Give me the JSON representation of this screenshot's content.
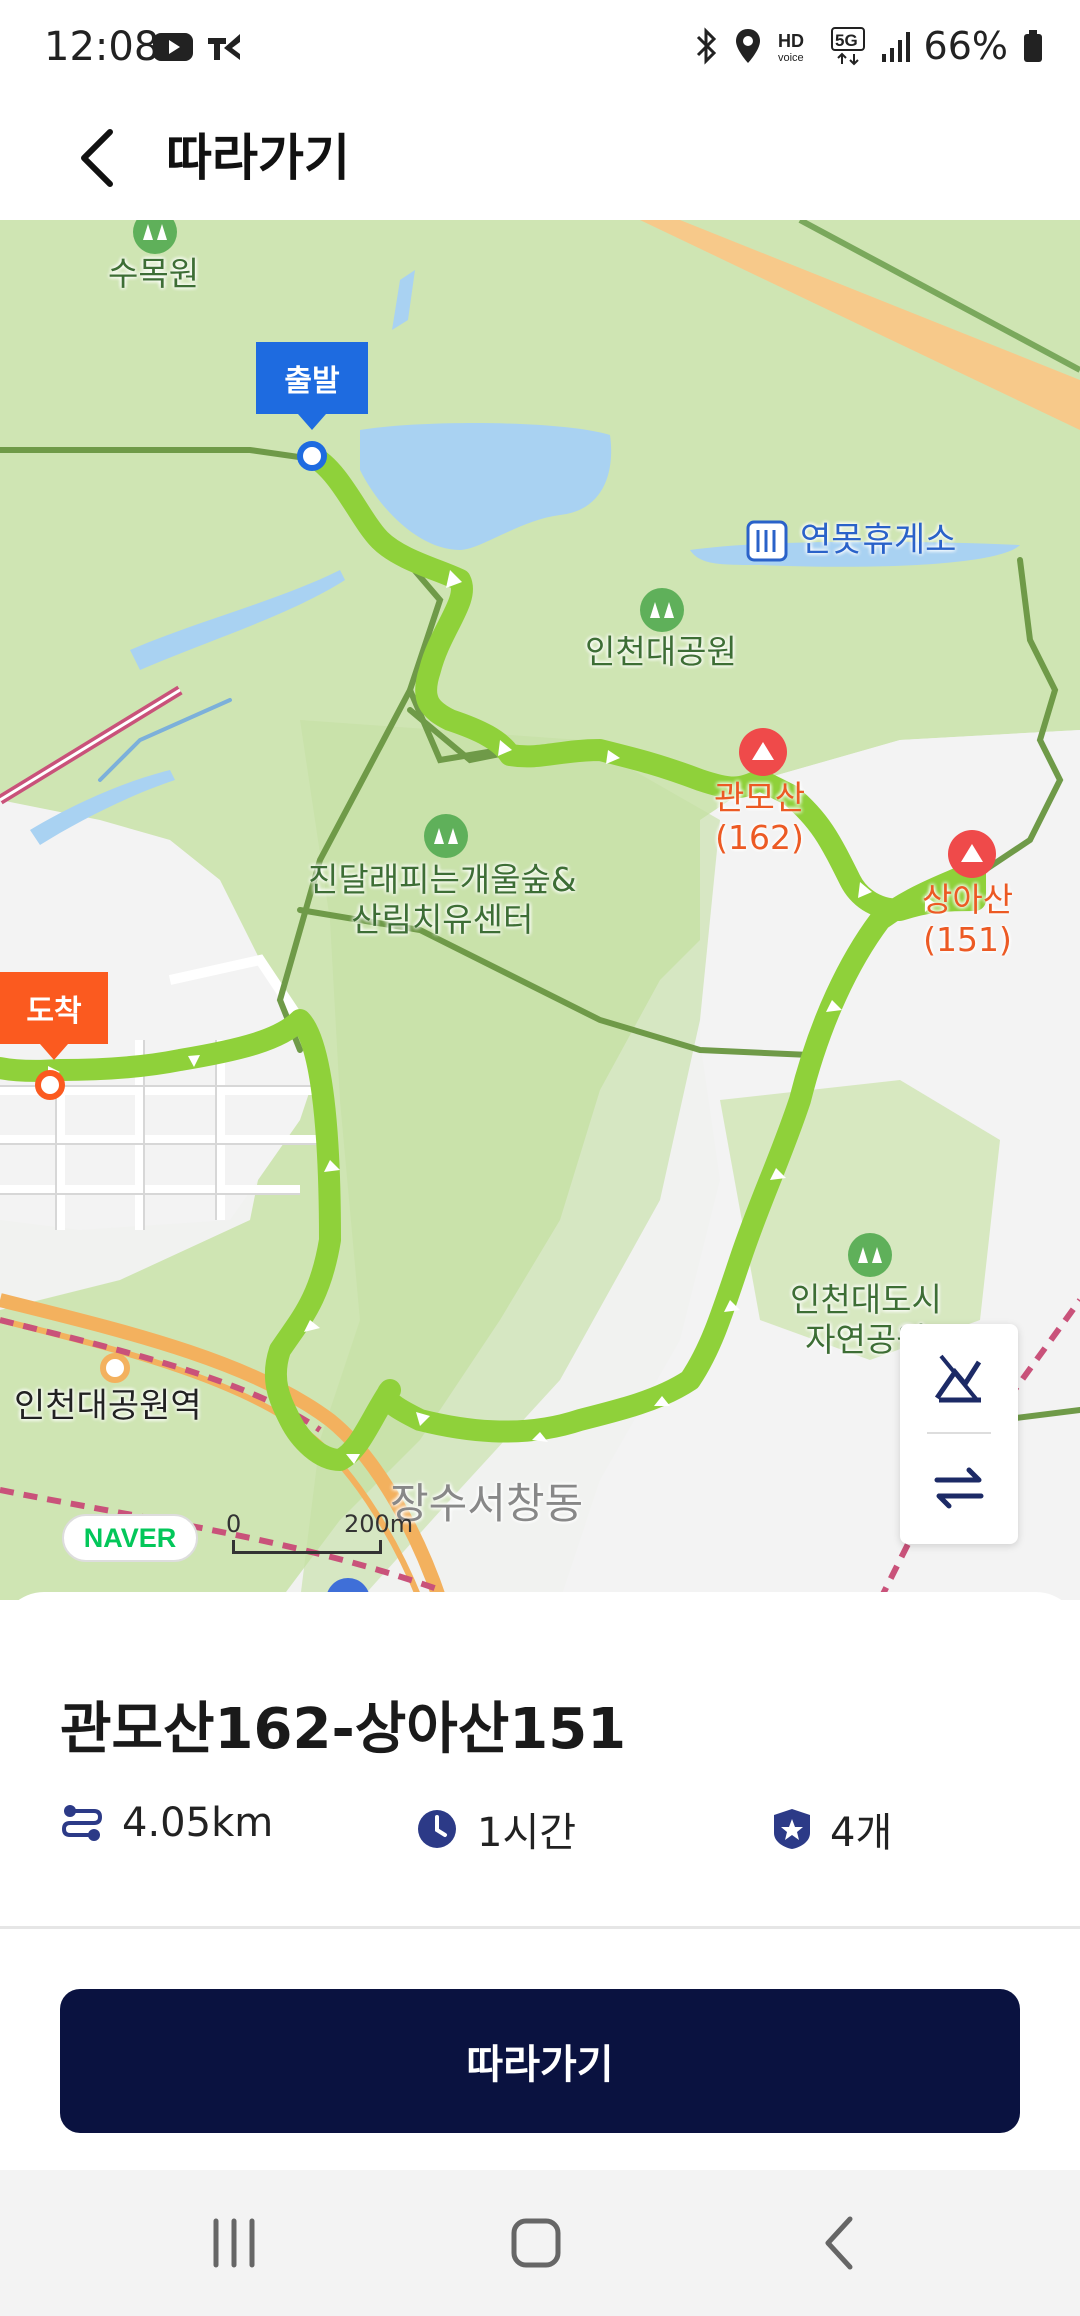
{
  "status_bar": {
    "time": "12:08",
    "battery": "66%",
    "icons": [
      "youtube-icon",
      "app-notification-icon",
      "bluetooth-icon",
      "location-icon",
      "hd-voice-icon",
      "5g-icon",
      "signal-icon",
      "battery-icon"
    ]
  },
  "header": {
    "title": "따라가기",
    "back_icon": "chevron-left-icon"
  },
  "map": {
    "start_label": "출발",
    "end_label": "도착",
    "places": {
      "sumokwon": "수목원",
      "rest_area": "연못휴게소",
      "grand_park": "인천대공원",
      "gwanmosan_name": "관모산",
      "gwanmosan_height": "(162)",
      "sangasan_name": "상아산",
      "sangasan_height": "(151)",
      "azalea_forest_line1": "진달래피는개울숲&",
      "azalea_forest_line2": "산림치유센터",
      "city_park_line1": "인천대도시",
      "city_park_line2": "자연공원",
      "station": "인천대공원역",
      "district": "장수서창동"
    },
    "logo": "NAVER",
    "scale": {
      "zero": "0",
      "distance": "200m"
    },
    "colors": {
      "route": "#8fd13a",
      "trail": "#6f9a48",
      "park": "#c9e2a9",
      "water": "#a9d2f2"
    }
  },
  "route": {
    "title": "관모산162-상아산151",
    "distance": "4.05km",
    "duration": "1시간",
    "stamps": "4개"
  },
  "actions": {
    "follow_label": "따라가기"
  },
  "colors": {
    "primary": "#0a1240",
    "start_pin": "#1e6be0",
    "end_pin": "#fb5a1f",
    "icon_navy": "#2c3a87"
  }
}
